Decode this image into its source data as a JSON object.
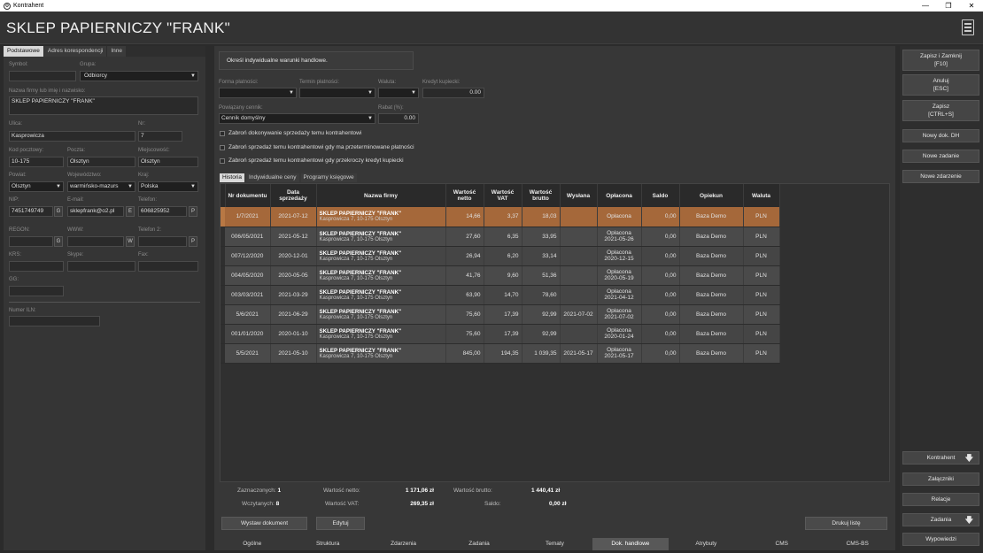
{
  "window": {
    "title": "Kontrahent",
    "controls": [
      "—",
      "❐",
      "✕"
    ]
  },
  "header": {
    "name": "SKLEP PAPIERNICZY \"FRANK\""
  },
  "left": {
    "tabs": [
      "Podstawowe",
      "Adres korespondencji",
      "Inne"
    ],
    "fields": {
      "symbol_label": "Symbol:",
      "symbol": "",
      "grupa_label": "Grupa:",
      "grupa": "Odbiorcy",
      "nazwa_label": "Nazwa firmy lub imię i nazwisko:",
      "nazwa": "SKLEP PAPIERNICZY \"FRANK\"",
      "ulica_label": "Ulica:",
      "ulica": "Kasprowicza",
      "nr_label": "Nr:",
      "nr": "7",
      "kod_label": "Kod pocztowy:",
      "kod": "10-175",
      "poczta_label": "Poczta:",
      "poczta": "Olsztyn",
      "miejscowosc_label": "Miejscowość:",
      "miejscowosc": "Olsztyn",
      "powiat_label": "Powiat:",
      "powiat": "Olsztyn",
      "woj_label": "Województwo:",
      "woj": "warmińsko-mazurs",
      "kraj_label": "Kraj:",
      "kraj": "Polska",
      "nip_label": "NIP:",
      "nip": "7451749749",
      "nip_btn": "G",
      "email_label": "E-mail:",
      "email": "sklepfrank@o2.pl",
      "email_btn": "E",
      "tel_label": "Telefon:",
      "tel": "606825952",
      "tel_btn": "P",
      "regon_label": "REGON:",
      "regon_btn": "G",
      "www_label": "WWW:",
      "www_btn": "W",
      "tel2_label": "Telefon 2:",
      "tel2_btn": "P",
      "krs_label": "KRS:",
      "skype_label": "Skype:",
      "fax_label": "Fax:",
      "gg_label": "GG:",
      "iln_label": "Numer ILN:"
    }
  },
  "center": {
    "info": "Określ indywidualne warunki handlowe.",
    "forma_label": "Forma płatności:",
    "termin_label": "Termin płatności:",
    "waluta_label": "Waluta:",
    "kredyt_label": "Kredyt kupiecki:",
    "kredyt": "0.00",
    "cennik_label": "Powiązany cennik:",
    "cennik": "Cennik domyślny",
    "rabat_label": "Rabat (%):",
    "rabat": "0.00",
    "checks": [
      "Zabroń dokonywanie sprzedaży temu kontrahentowi",
      "Zabroń sprzedaż temu kontrahentowi gdy ma przeterminowane płatności",
      "Zabroń sprzedaż temu kontrahentowi gdy przekroczy kredyt kupiecki"
    ],
    "tabs": [
      "Historia",
      "Indywidualne ceny",
      "Programy księgowe"
    ],
    "columns": [
      "Nr dokumentu",
      "Data sprzedaży",
      "Nazwa firmy",
      "Wartość netto",
      "Wartość VAT",
      "Wartość brutto",
      "Wysłana",
      "Opłacona",
      "Saldo",
      "Opiekun",
      "Waluta"
    ],
    "rows": [
      {
        "nr": "1/7/2021",
        "data": "2021-07-12",
        "firma": "SKLEP PAPIERNICZY \"FRANK\"",
        "adres": "Kasprowicza 7, 10-175 Olsztyn",
        "netto": "14,66",
        "vat": "3,37",
        "brutto": "18,03",
        "wyslana": "",
        "oplacona": "Opłacona",
        "oplacona_data": "",
        "saldo": "0,00",
        "opiekun": "Baza Demo",
        "waluta": "PLN"
      },
      {
        "nr": "006/05/2021",
        "data": "2021-05-12",
        "firma": "SKLEP PAPIERNICZY \"FRANK\"",
        "adres": "Kasprowicza 7, 10-175 Olsztyn",
        "netto": "27,60",
        "vat": "6,35",
        "brutto": "33,95",
        "wyslana": "",
        "oplacona": "Opłacona",
        "oplacona_data": "2021-05-26",
        "saldo": "0,00",
        "opiekun": "Baza Demo",
        "waluta": "PLN"
      },
      {
        "nr": "007/12/2020",
        "data": "2020-12-01",
        "firma": "SKLEP PAPIERNICZY \"FRANK\"",
        "adres": "Kasprowicza 7, 10-175 Olsztyn",
        "netto": "26,94",
        "vat": "6,20",
        "brutto": "33,14",
        "wyslana": "",
        "oplacona": "Opłacona",
        "oplacona_data": "2020-12-15",
        "saldo": "0,00",
        "opiekun": "Baza Demo",
        "waluta": "PLN"
      },
      {
        "nr": "004/05/2020",
        "data": "2020-05-05",
        "firma": "SKLEP PAPIERNICZY \"FRANK\"",
        "adres": "Kasprowicza 7, 10-175 Olsztyn",
        "netto": "41,76",
        "vat": "9,60",
        "brutto": "51,36",
        "wyslana": "",
        "oplacona": "Opłacona",
        "oplacona_data": "2020-05-19",
        "saldo": "0,00",
        "opiekun": "Baza Demo",
        "waluta": "PLN"
      },
      {
        "nr": "003/03/2021",
        "data": "2021-03-29",
        "firma": "SKLEP PAPIERNICZY \"FRANK\"",
        "adres": "Kasprowicza 7, 10-175 Olsztyn",
        "netto": "63,90",
        "vat": "14,70",
        "brutto": "78,60",
        "wyslana": "",
        "oplacona": "Opłacona",
        "oplacona_data": "2021-04-12",
        "saldo": "0,00",
        "opiekun": "Baza Demo",
        "waluta": "PLN"
      },
      {
        "nr": "5/6/2021",
        "data": "2021-06-29",
        "firma": "SKLEP PAPIERNICZY \"FRANK\"",
        "adres": "Kasprowicza 7, 10-175 Olsztyn",
        "netto": "75,60",
        "vat": "17,39",
        "brutto": "92,99",
        "wyslana": "2021-07-02",
        "oplacona": "Opłacona",
        "oplacona_data": "2021-07-02",
        "saldo": "0,00",
        "opiekun": "Baza Demo",
        "waluta": "PLN"
      },
      {
        "nr": "001/01/2020",
        "data": "2020-01-10",
        "firma": "SKLEP PAPIERNICZY \"FRANK\"",
        "adres": "Kasprowicza 7, 10-175 Olsztyn",
        "netto": "75,60",
        "vat": "17,39",
        "brutto": "92,99",
        "wyslana": "",
        "oplacona": "Opłacona",
        "oplacona_data": "2020-01-24",
        "saldo": "0,00",
        "opiekun": "Baza Demo",
        "waluta": "PLN"
      },
      {
        "nr": "5/5/2021",
        "data": "2021-05-10",
        "firma": "SKLEP PAPIERNICZY \"FRANK\"",
        "adres": "Kasprowicza 7, 10-175 Olsztyn",
        "netto": "845,00",
        "vat": "194,35",
        "brutto": "1 039,35",
        "wyslana": "2021-05-17",
        "oplacona": "Opłacona",
        "oplacona_data": "2021-05-17",
        "saldo": "0,00",
        "opiekun": "Baza Demo",
        "waluta": "PLN"
      }
    ],
    "summary": {
      "zazn_label": "Zaznaczonych:",
      "zazn": "1",
      "wczyt_label": "Wczytanych:",
      "wczyt": "8",
      "netto_label": "Wartość netto:",
      "netto": "1 171,06 zł",
      "vat_label": "Wartość VAT:",
      "vat": "269,35 zł",
      "brutto_label": "Wartość brutto:",
      "brutto": "1 440,41 zł",
      "saldo_label": "Saldo:",
      "saldo": "0,00 zł"
    },
    "buttons": {
      "wystaw": "Wystaw dokument",
      "edytuj": "Edytuj",
      "drukuj": "Drukuj listę"
    },
    "bottom_tabs": [
      "Ogólne",
      "Struktura",
      "Zdarzenia",
      "Zadania",
      "Tematy",
      "Dok. handlowe",
      "Atrybuty",
      "CMS",
      "CMS-BS"
    ]
  },
  "right": {
    "zapisz_zamknij": "Zapisz i Zamknij",
    "zapisz_zamknij_key": "[F10]",
    "anuluj": "Anuluj",
    "anuluj_key": "[ESC]",
    "zapisz": "Zapisz",
    "zapisz_key": "[CTRL+S]",
    "nowy_dok": "Nowy dok. DH",
    "nowe_zadanie": "Nowe zadanie",
    "nowe_zdarzenie": "Nowe zdarzenie",
    "kontrahent": "Kontrahent",
    "zalaczniki": "Załączniki",
    "relacje": "Relacje",
    "zadania": "Zadania",
    "wypowiedzi": "Wypowiedzi"
  }
}
